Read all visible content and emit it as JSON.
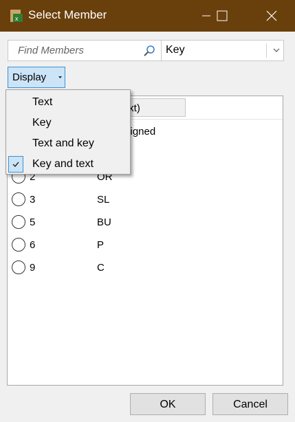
{
  "window": {
    "title": "Select Member",
    "icons": {
      "app": "app-icon",
      "minimize": "minimize-icon",
      "maximize": "maximize-icon",
      "close": "close-icon"
    },
    "title_bar_color": "#693f0c"
  },
  "search": {
    "placeholder": "Find Members",
    "value": "",
    "icon": "search-icon"
  },
  "key_select": {
    "selected": "Key",
    "icon": "chevron-down-icon"
  },
  "display_button": {
    "label": "Display",
    "icon": "chevron-down-icon"
  },
  "display_menu": {
    "items": [
      {
        "label": "Text",
        "checked": false
      },
      {
        "label": "Key",
        "checked": false
      },
      {
        "label": "Text and key",
        "checked": false
      },
      {
        "label": "Key and text",
        "checked": true
      }
    ]
  },
  "list": {
    "column_header_visible": "er(Text)",
    "first_row_text_visible": "signed",
    "rows": [
      {
        "key": "2",
        "text": "OR"
      },
      {
        "key": "3",
        "text": "SL"
      },
      {
        "key": "5",
        "text": "BU"
      },
      {
        "key": "6",
        "text": "P"
      },
      {
        "key": "9",
        "text": "C"
      }
    ]
  },
  "buttons": {
    "ok": "OK",
    "cancel": "Cancel"
  },
  "colors": {
    "accent": "#3c8fd0",
    "selection": "#cce4f7"
  }
}
